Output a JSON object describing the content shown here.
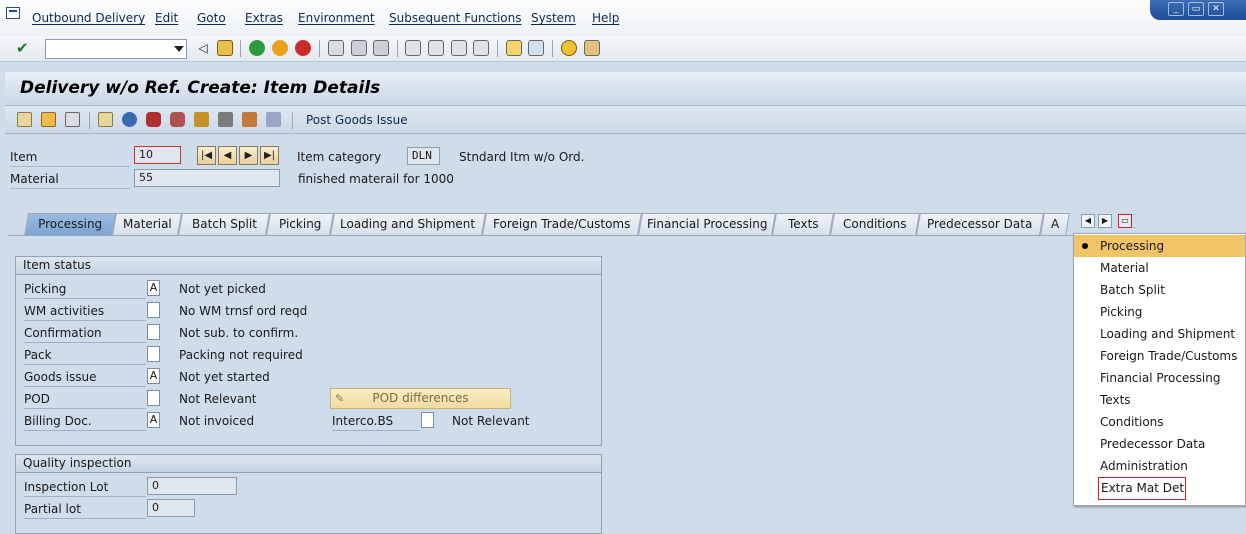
{
  "menubar": {
    "items": [
      "Outbound Delivery",
      "Edit",
      "Goto",
      "Extras",
      "Environment",
      "Subsequent Functions",
      "System",
      "Help"
    ],
    "window_buttons": [
      "minimize-icon",
      "restore-icon",
      "close-icon"
    ]
  },
  "toolbar": {
    "command_field": {
      "value": "",
      "placeholder": ""
    },
    "icons": [
      "enter-icon",
      "back-icon",
      "save-icon",
      "back-green-icon",
      "exit-icon",
      "cancel-icon",
      "print-icon",
      "find-icon",
      "find-next-icon",
      "first-page-icon",
      "prev-page-icon",
      "next-page-icon",
      "last-page-icon",
      "create-session-icon",
      "shortcut-icon",
      "help-icon",
      "layout-icon"
    ]
  },
  "title": "Delivery w/o Ref. Create: Item Details",
  "app_toolbar": {
    "icons": [
      "edit-icon",
      "copy-icon",
      "delete-icon",
      "display-icon",
      "partner-icon",
      "batch-icon",
      "picking-icon",
      "packing-icon",
      "shipment-icon",
      "home-icon",
      "details-icon"
    ],
    "post_goods_issue": "Post Goods Issue"
  },
  "header": {
    "item_label": "Item",
    "item_value": "10",
    "item_category_label": "Item category",
    "item_category_value": "DLN",
    "item_category_desc": "Stndard Itm w/o Ord.",
    "material_label": "Material",
    "material_value": "55",
    "material_desc": "finished materail for 1000",
    "nav": [
      "|◀",
      "◀",
      "▶",
      "▶|"
    ]
  },
  "tabs": [
    "Processing",
    "Material",
    "Batch Split",
    "Picking",
    "Loading and Shipment",
    "Foreign Trade/Customs",
    "Financial Processing",
    "Texts",
    "Conditions",
    "Predecessor Data",
    "A"
  ],
  "active_tab": "Processing",
  "item_status": {
    "title": "Item status",
    "rows": [
      {
        "label": "Picking",
        "value": "A",
        "desc": "Not yet picked"
      },
      {
        "label": "WM activities",
        "value": "",
        "desc": "No WM trnsf ord reqd"
      },
      {
        "label": "Confirmation",
        "value": "",
        "desc": "Not sub. to confirm."
      },
      {
        "label": "Pack",
        "value": "",
        "desc": "Packing not required"
      },
      {
        "label": "Goods issue",
        "value": "A",
        "desc": "Not yet started"
      },
      {
        "label": "POD",
        "value": "",
        "desc": "Not Relevant"
      },
      {
        "label": "Billing Doc.",
        "value": "A",
        "desc": "Not invoiced"
      }
    ],
    "pod_button": "POD differences",
    "interco_label": "Interco.BS",
    "interco_value": "",
    "interco_desc": "Not Relevant"
  },
  "quality": {
    "title": "Quality inspection",
    "rows": [
      {
        "label": "Inspection Lot",
        "value": "0"
      },
      {
        "label": "Partial lot",
        "value": "0"
      }
    ]
  },
  "tab_dropdown": {
    "items": [
      "Processing",
      "Material",
      "Batch Split",
      "Picking",
      "Loading and Shipment",
      "Foreign Trade/Customs",
      "Financial Processing",
      "Texts",
      "Conditions",
      "Predecessor Data",
      "Administration",
      "Extra Mat Det"
    ],
    "selected": "Processing",
    "highlighted": "Extra Mat Det"
  },
  "colors": {
    "accent": "#7aa2d2",
    "highlight_box": "#d11f2a",
    "selected_row": "#f2c468"
  }
}
